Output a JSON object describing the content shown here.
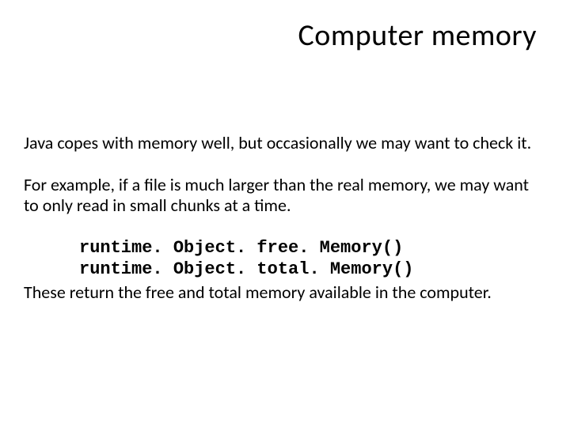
{
  "title": "Computer memory",
  "para1": "Java copes with memory well, but occasionally we may want to check it.",
  "para2": "For example, if a file is much larger than the real memory, we may want to only read in small chunks at a time.",
  "code": {
    "line1": "runtime. Object. free. Memory()",
    "line2": "runtime. Object. total. Memory()"
  },
  "para3": "These return the free and total memory available in the computer."
}
